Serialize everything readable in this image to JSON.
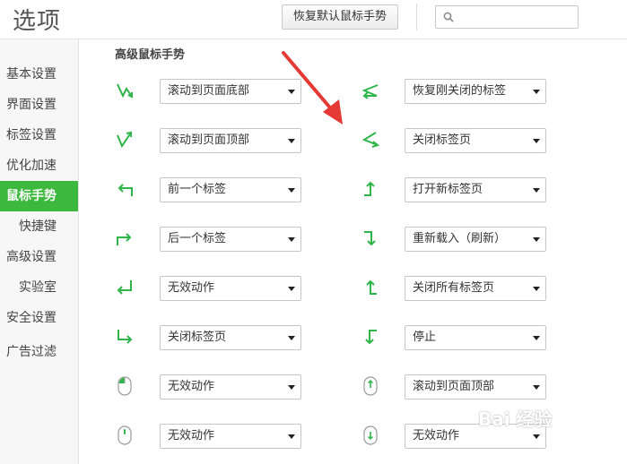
{
  "header": {
    "title": "选项",
    "restore_button": "恢复默认鼠标手势",
    "search_placeholder": ""
  },
  "sidebar": {
    "items": [
      {
        "label": "基本设置",
        "active": false
      },
      {
        "label": "界面设置",
        "active": false
      },
      {
        "label": "标签设置",
        "active": false
      },
      {
        "label": "优化加速",
        "active": false
      },
      {
        "label": "鼠标手势",
        "active": true
      },
      {
        "label": "快捷键",
        "active": false
      },
      {
        "label": "高级设置",
        "active": false
      },
      {
        "label": "实验室",
        "active": false
      },
      {
        "label": "安全设置",
        "active": false
      },
      {
        "label": "广告过滤",
        "active": false
      }
    ]
  },
  "main": {
    "section_title": "高级鼠标手势",
    "left": [
      {
        "icon": "gesture-down-up-icon",
        "action": "滚动到页面底部"
      },
      {
        "icon": "gesture-up-down-icon",
        "action": "滚动到页面顶部"
      },
      {
        "icon": "gesture-left-icon",
        "action": "前一个标签"
      },
      {
        "icon": "gesture-right-icon",
        "action": "后一个标签"
      },
      {
        "icon": "gesture-down-left-icon",
        "action": "无效动作"
      },
      {
        "icon": "gesture-down-right-icon",
        "action": "关闭标签页"
      },
      {
        "icon": "mouse-left-button-icon",
        "action": "无效动作"
      },
      {
        "icon": "mouse-wheel-icon",
        "action": "无效动作"
      }
    ],
    "right": [
      {
        "icon": "gesture-zigzag-left-icon",
        "action": "恢复刚关闭的标签"
      },
      {
        "icon": "gesture-left-right-icon",
        "action": "关闭标签页"
      },
      {
        "icon": "gesture-right-up-icon",
        "action": "打开新标签页"
      },
      {
        "icon": "gesture-right-down-icon",
        "action": "重新载入（刷新）"
      },
      {
        "icon": "gesture-left-up-icon",
        "action": "关闭所有标签页"
      },
      {
        "icon": "gesture-left-down-icon",
        "action": "停止"
      },
      {
        "icon": "mouse-wheel-up-icon",
        "action": "滚动到页面顶部"
      },
      {
        "icon": "mouse-wheel-down-icon",
        "action": "无效动作"
      }
    ]
  },
  "watermark": "Bai 经验",
  "colors": {
    "accent": "#3cb83c",
    "icon_green": "#2fb54a",
    "pointer_red": "#e53935"
  }
}
